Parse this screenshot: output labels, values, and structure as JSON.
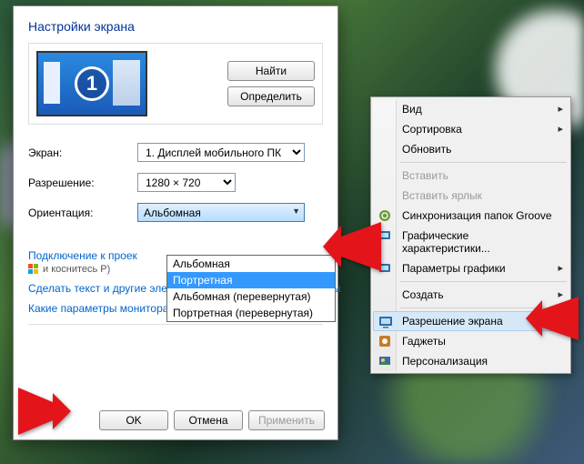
{
  "dialog": {
    "title": "Настройки экрана",
    "find_btn": "Найти",
    "detect_btn": "Определить",
    "monitor_number": "1",
    "screen_label": "Экран:",
    "screen_value": "1. Дисплей мобильного ПК",
    "resolution_label": "Разрешение:",
    "resolution_value": "1280 × 720",
    "orientation_label": "Ориентация:",
    "orientation_value": "Альбомная",
    "orientation_options": [
      "Альбомная",
      "Портретная",
      "Альбомная (перевернутая)",
      "Портретная (перевернутая)"
    ],
    "orientation_selected_index": 1,
    "projector_link": "Подключение к проек",
    "projector_hint": "и коснитесь P)",
    "link_textsize": "Сделать текст и другие элементы больше или меньше",
    "link_which": "Какие параметры монитора следует выбрать?",
    "ok": "OK",
    "cancel": "Отмена",
    "apply": "Применить",
    "dropdown_trail_char": "ы"
  },
  "context_menu": {
    "items": [
      {
        "label": "Вид",
        "submenu": true
      },
      {
        "label": "Сортировка",
        "submenu": true
      },
      {
        "label": "Обновить"
      },
      {
        "sep": true
      },
      {
        "label": "Вставить",
        "disabled": true
      },
      {
        "label": "Вставить ярлык",
        "disabled": true
      },
      {
        "label": "Синхронизация папок Groove",
        "icon": "sync"
      },
      {
        "label": "Графические характеристики...",
        "icon": "gfx"
      },
      {
        "label": "Параметры графики",
        "submenu": true,
        "icon": "gfx"
      },
      {
        "sep": true
      },
      {
        "label": "Создать",
        "submenu": true
      },
      {
        "sep": true
      },
      {
        "label": "Разрешение экрана",
        "icon": "screen",
        "highlight": true
      },
      {
        "label": "Гаджеты",
        "icon": "gadget"
      },
      {
        "label": "Персонализация",
        "icon": "pers"
      }
    ]
  }
}
